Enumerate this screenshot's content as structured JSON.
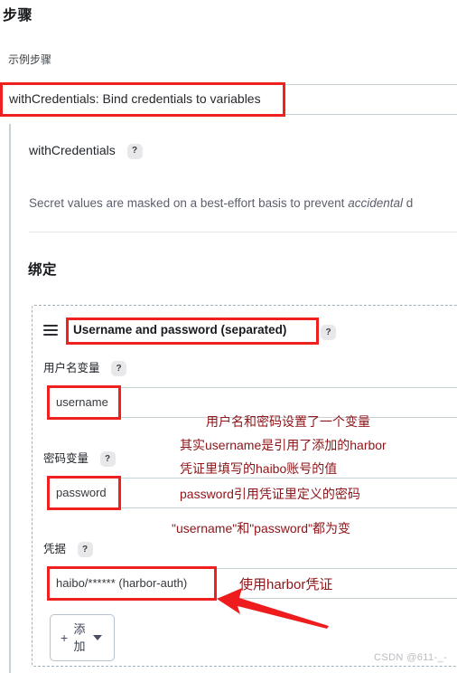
{
  "page": {
    "title": "步骤",
    "sample_steps_label": "示例步骤",
    "watermark": "CSDN @611-_-"
  },
  "step_selector": {
    "selected_value": "withCredentials: Bind credentials to variables"
  },
  "with_credentials": {
    "title": "withCredentials",
    "help_glyph": "?",
    "description_prefix": "Secret values are masked on a best-effort basis to prevent ",
    "description_italic": "accidental",
    "description_suffix": " d"
  },
  "binding_section": {
    "heading": "绑定",
    "drag_handle_icon": "hamburger-icon",
    "kind_label": "Username and password (separated)",
    "kind_help_glyph": "?",
    "fields": [
      {
        "label": "用户名变量",
        "help_glyph": "?",
        "value": "username"
      },
      {
        "label": "密码变量",
        "help_glyph": "?",
        "value": "password"
      },
      {
        "label": "凭据",
        "help_glyph": "?",
        "value": "haibo/****** (harbor-auth)"
      }
    ],
    "add_button": {
      "plus_glyph": "+",
      "label": "添加",
      "caret_icon": "caret-down-icon"
    }
  },
  "annotations": {
    "highlight_color": "#ef2020",
    "text_color": "#8e1418",
    "arrow_color": "#ee1c1c",
    "notes": [
      "用户名和密码设置了一个变量",
      "其实username是引用了添加的harbor",
      "凭证里填写的haibo账号的值",
      "password引用凭证里定义的密码",
      "\"username\"和\"password\"都为变",
      "使用harbor凭证"
    ]
  }
}
